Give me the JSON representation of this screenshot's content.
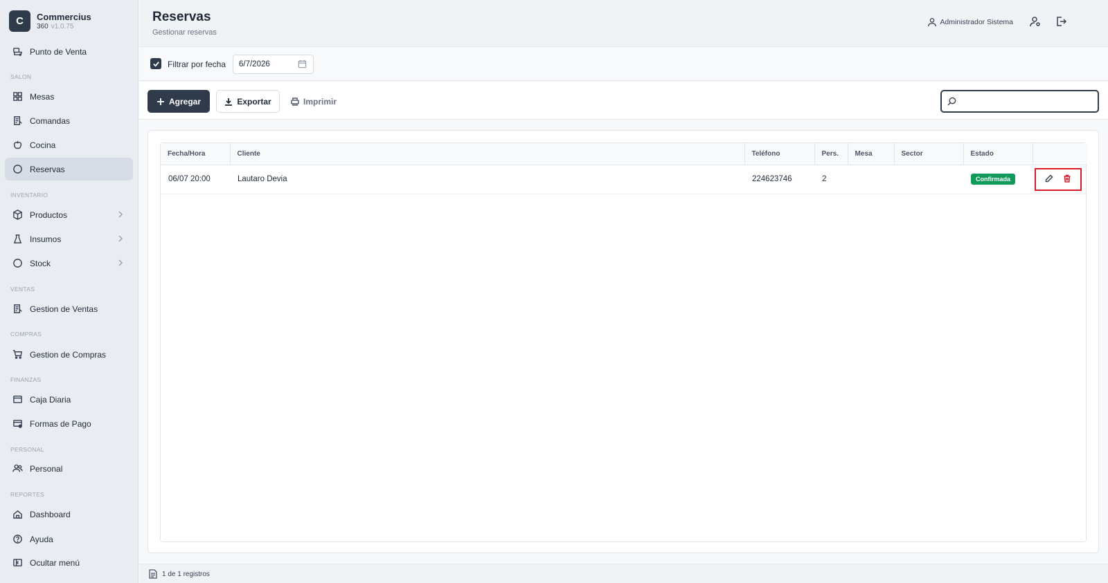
{
  "brand": {
    "logo_letter": "C",
    "name": "Commercius",
    "product": "360",
    "version": "v1.0.75"
  },
  "sidebar": {
    "pos": {
      "label": "Punto de Venta",
      "icon": "pos-icon"
    },
    "sections": {
      "salon": "SALON",
      "inventario": "INVENTARIO",
      "ventas": "VENTAS",
      "compras": "COMPRAS",
      "finanzas": "FINANZAS",
      "personal": "PERSONAL",
      "reportes": "REPORTES"
    },
    "items": {
      "mesas": "Mesas",
      "comandas": "Comandas",
      "cocina": "Cocina",
      "reservas": "Reservas",
      "productos": "Productos",
      "insumos": "Insumos",
      "stock": "Stock",
      "gestion_ventas": "Gestion de Ventas",
      "gestion_compras": "Gestion de Compras",
      "caja_diaria": "Caja Diaria",
      "formas_pago": "Formas de Pago",
      "personal": "Personal",
      "dashboard": "Dashboard",
      "ayuda": "Ayuda",
      "ocultar": "Ocultar menú"
    },
    "active": "reservas"
  },
  "header": {
    "title": "Reservas",
    "subtitle": "Gestionar reservas",
    "user": "Administrador Sistema"
  },
  "filter": {
    "checked": true,
    "label": "Filtrar por fecha",
    "date": "6/7/2026"
  },
  "toolbar": {
    "add_label": "Agregar",
    "export_label": "Exportar",
    "print_label": "Imprimir",
    "search_placeholder": ""
  },
  "table": {
    "columns": [
      "Fecha/Hora",
      "Cliente",
      "Teléfono",
      "Pers.",
      "Mesa",
      "Sector",
      "Estado",
      ""
    ],
    "rows": [
      {
        "fecha": "06/07 20:00",
        "cliente": "Lautaro Devia",
        "telefono": "224623746",
        "pers": "2",
        "mesa": "",
        "sector": "",
        "estado": "Confirmada"
      }
    ]
  },
  "footer": {
    "records": "1 de 1 registros"
  },
  "colors": {
    "primary": "#2f3a4a",
    "success": "#0f9a5c",
    "danger": "#d81b2a",
    "highlight": "#d81b2a"
  }
}
